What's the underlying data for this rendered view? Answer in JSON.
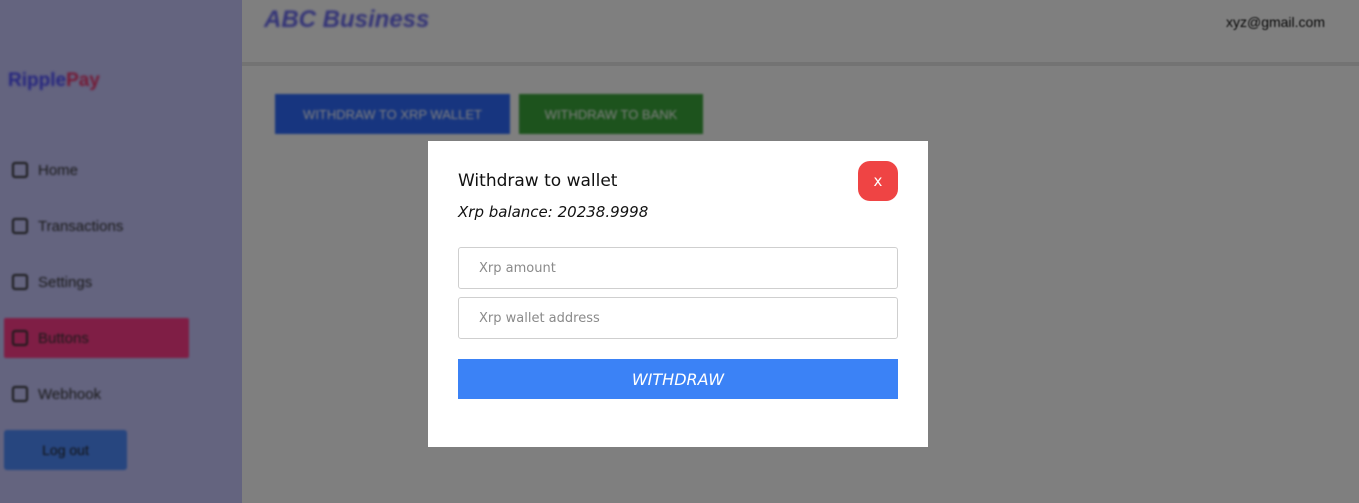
{
  "sidebar": {
    "brand_part1": "Ripple",
    "brand_part2": "Pay",
    "items": [
      {
        "label": "Home",
        "icon": "home-icon"
      },
      {
        "label": "Transactions",
        "icon": "list-icon"
      },
      {
        "label": "Settings",
        "icon": "gear-icon"
      },
      {
        "label": "Buttons",
        "icon": "button-icon",
        "active": true
      },
      {
        "label": "Webhook",
        "icon": "webhook-icon"
      }
    ],
    "logout_label": "Log out"
  },
  "header": {
    "business_name": "ABC Business",
    "user_email": "xyz@gmail.com"
  },
  "tabs": {
    "xrp_wallet_label": "WITHDRAW TO XRP WALLET",
    "bank_label": "WITHDRAW TO BANK"
  },
  "modal": {
    "title": "Withdraw to wallet",
    "close_label": "x",
    "balance_text": "Xrp balance: 20238.9998",
    "amount_placeholder": "Xrp amount",
    "address_placeholder": "Xrp wallet address",
    "submit_label": "WITHDRAW"
  },
  "colors": {
    "sidebar_bg": "#c8c8ff",
    "active_item": "#ff3d8b",
    "primary": "#3b82f6",
    "danger": "#ef4444",
    "success": "#3aa63a"
  }
}
